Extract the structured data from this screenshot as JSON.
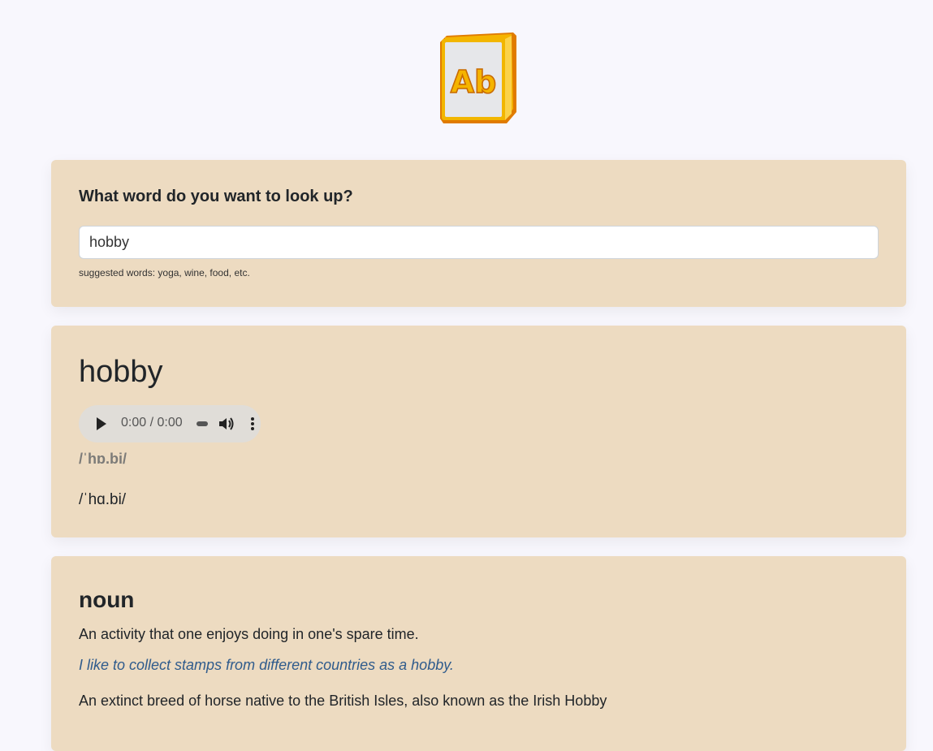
{
  "logo": {
    "text": "Ab",
    "icon": "dictionary-book-icon",
    "colors": {
      "gold": "#f5b400",
      "orange": "#e07b00",
      "page": "#e6e7ea"
    }
  },
  "search": {
    "label": "What word do you want to look up?",
    "value": "hobby",
    "hint": "suggested words: yoga, wine, food, etc."
  },
  "word": {
    "title": "hobby",
    "audio": {
      "time": "0:00 / 0:00"
    },
    "phonetic_primary": "/ˈhɒ.bi/",
    "phonetic_secondary": "/ˈhɑ.bi/"
  },
  "definitions": {
    "part_of_speech": "noun",
    "items": [
      {
        "text": "An activity that one enjoys doing in one's spare time."
      },
      {
        "example": "I like to collect stamps from different countries as a hobby."
      },
      {
        "text": "An extinct breed of horse native to the British Isles, also known as the Irish Hobby"
      }
    ]
  },
  "theme": {
    "page_bg": "#f8f7fd",
    "card_bg": "#eddbc1",
    "example_color": "#2f5b8c"
  }
}
